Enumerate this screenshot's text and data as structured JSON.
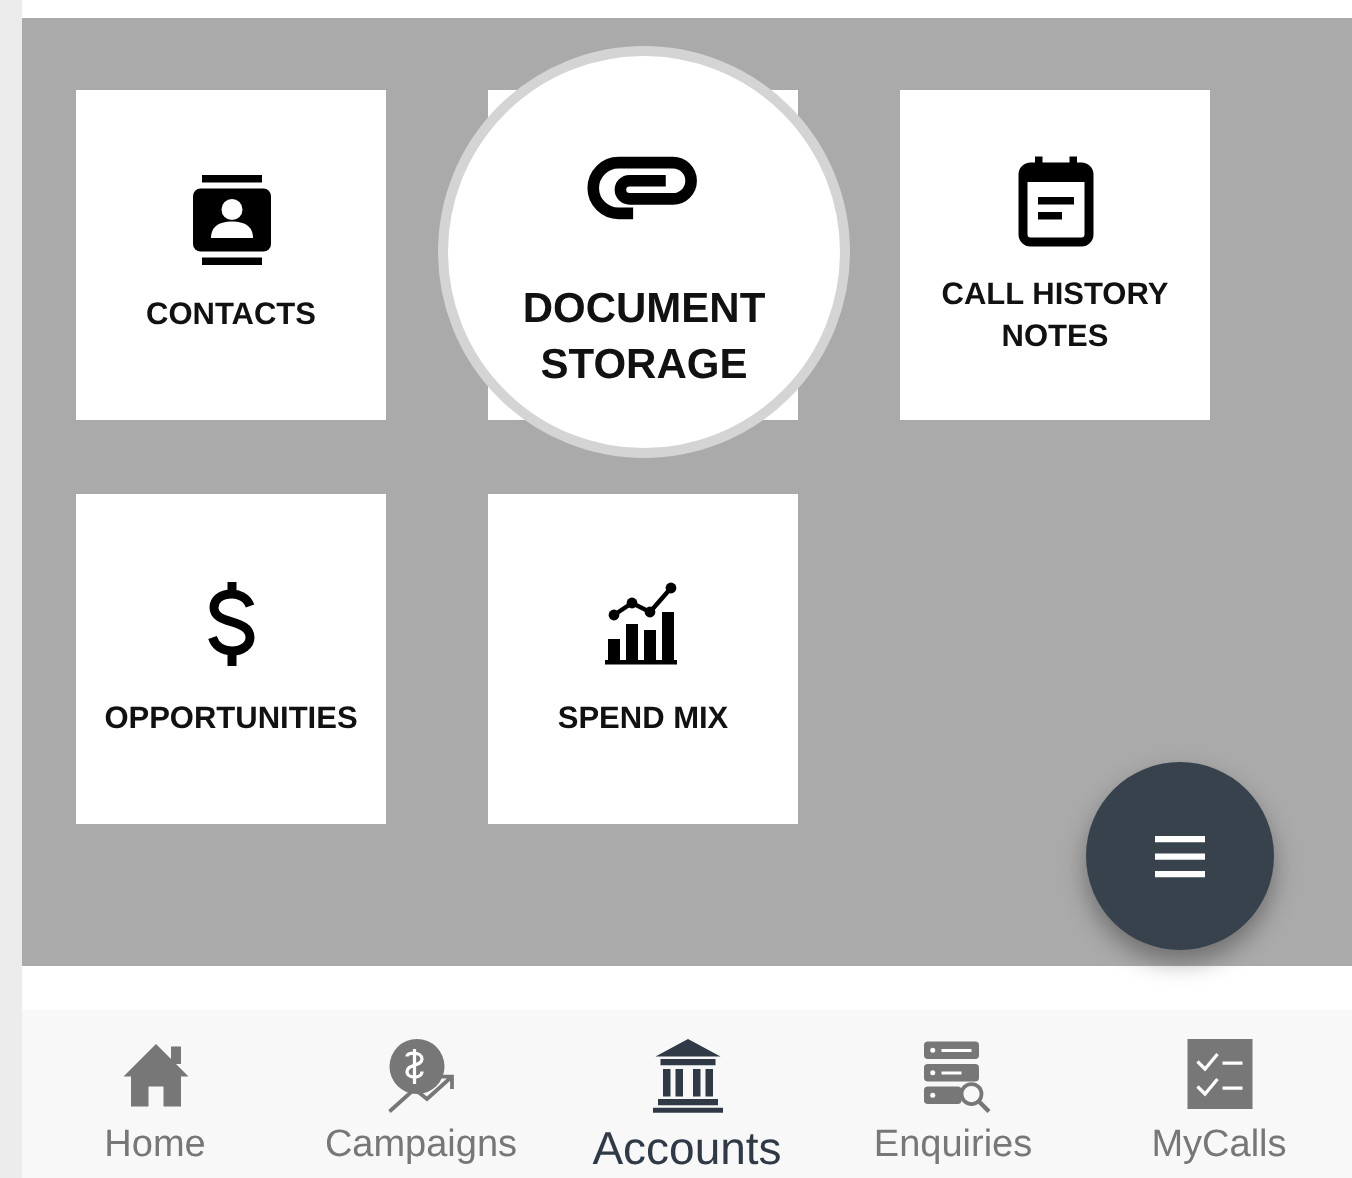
{
  "tiles": [
    {
      "label": "CONTACTS",
      "magnified": false
    },
    {
      "label": "DOCUMENT STORAGE",
      "magnified": true
    },
    {
      "label": "CALL HISTORY NOTES",
      "magnified": false
    },
    {
      "label": "OPPORTUNITIES",
      "magnified": false
    },
    {
      "label": "SPEND MIX",
      "magnified": false
    }
  ],
  "bottom_nav": [
    {
      "label": "Home",
      "selected": false
    },
    {
      "label": "Campaigns",
      "selected": false
    },
    {
      "label": "Accounts",
      "selected": true
    },
    {
      "label": "Enquiries",
      "selected": false
    },
    {
      "label": "MyCalls",
      "selected": false
    }
  ]
}
